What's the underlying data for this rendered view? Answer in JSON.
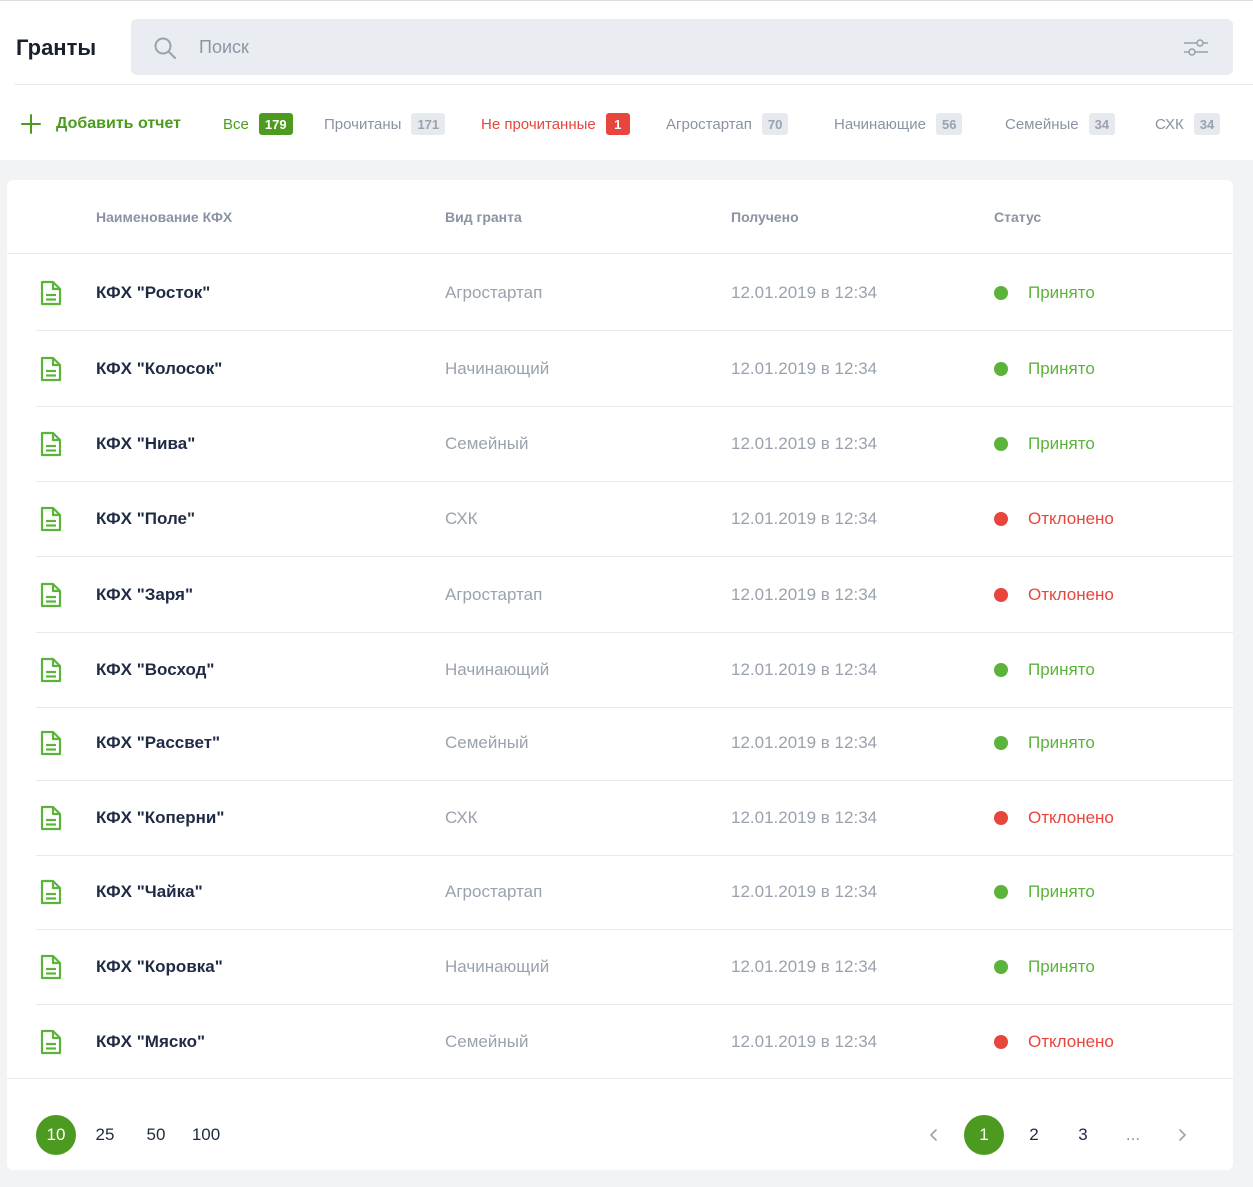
{
  "header": {
    "title": "Гранты",
    "search_placeholder": "Поиск"
  },
  "toolbar": {
    "add_label": "Добавить отчет",
    "tabs": [
      {
        "label": "Все",
        "count": "179"
      },
      {
        "label": "Прочитаны",
        "count": "171"
      },
      {
        "label": "Не прочитанные",
        "count": "1"
      },
      {
        "label": "Агростартап",
        "count": "70"
      },
      {
        "label": "Начинающие",
        "count": "56"
      },
      {
        "label": "Семейные",
        "count": "34"
      },
      {
        "label": "СХК",
        "count": "34"
      }
    ]
  },
  "table": {
    "columns": [
      "Наименование КФХ",
      "Вид гранта",
      "Получено",
      "Статус"
    ],
    "rows": [
      {
        "name": "КФХ \"Росток\"",
        "type": "Агростартап",
        "date": "12.01.2019 в 12:34",
        "status": "Принято"
      },
      {
        "name": "КФХ \"Колосок\"",
        "type": "Начинающий",
        "date": "12.01.2019 в 12:34",
        "status": "Принято"
      },
      {
        "name": "КФХ \"Нива\"",
        "type": "Семейный",
        "date": "12.01.2019 в 12:34",
        "status": "Принято"
      },
      {
        "name": "КФХ \"Поле\"",
        "type": "СХК",
        "date": "12.01.2019 в 12:34",
        "status": "Отклонено"
      },
      {
        "name": "КФХ \"Заря\"",
        "type": "Агростартап",
        "date": "12.01.2019 в 12:34",
        "status": "Отклонено"
      },
      {
        "name": "КФХ \"Восход\"",
        "type": "Начинающий",
        "date": "12.01.2019 в 12:34",
        "status": "Принято"
      },
      {
        "name": "КФХ \"Рассвет\"",
        "type": "Семейный",
        "date": "12.01.2019 в 12:34",
        "status": "Принято"
      },
      {
        "name": "КФХ \"Коперни\"",
        "type": "СХК",
        "date": "12.01.2019 в 12:34",
        "status": "Отклонено"
      },
      {
        "name": "КФХ \"Чайка\"",
        "type": "Агростартап",
        "date": "12.01.2019 в 12:34",
        "status": "Принято"
      },
      {
        "name": "КФХ \"Коровка\"",
        "type": "Начинающий",
        "date": "12.01.2019 в 12:34",
        "status": "Принято"
      },
      {
        "name": "КФХ \"Мяско\"",
        "type": "Семейный",
        "date": "12.01.2019 в 12:34",
        "status": "Отклонено"
      }
    ]
  },
  "pagination": {
    "page_sizes": [
      "10",
      "25",
      "50",
      "100"
    ],
    "active_size": "10",
    "pages": [
      "1",
      "2",
      "3"
    ],
    "active_page": "1",
    "ellipsis": "..."
  },
  "colors": {
    "accent": "#4c9a1f",
    "accepted": "#5bb33a",
    "rejected": "#e8453c"
  }
}
